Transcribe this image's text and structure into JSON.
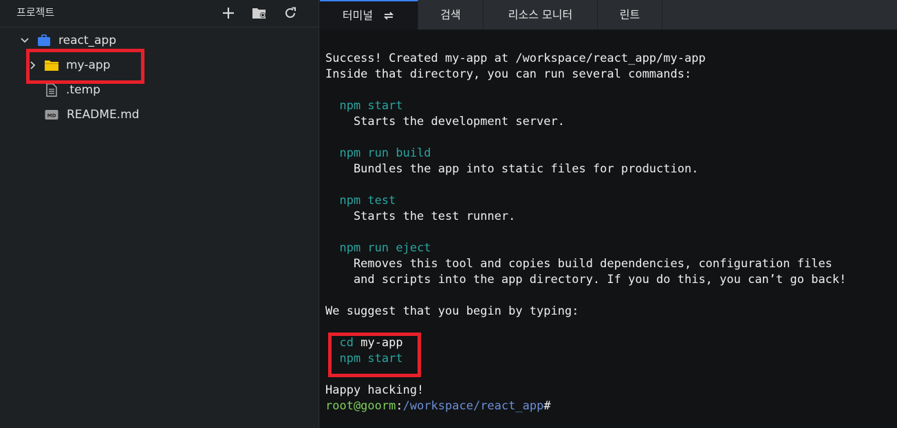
{
  "sidebar": {
    "title": "프로젝트",
    "icons": {
      "add": "plus-icon",
      "new_folder": "folder-settings-icon",
      "refresh": "refresh-icon"
    },
    "tree": [
      {
        "label": "react_app",
        "icon": "project-icon",
        "expanded": true
      },
      {
        "label": "my-app",
        "icon": "folder-icon",
        "expanded": false
      },
      {
        "label": ".temp",
        "icon": "file-icon"
      },
      {
        "label": "README.md",
        "icon": "markdown-file-icon",
        "badge": "MD"
      }
    ]
  },
  "tabs": [
    {
      "label": "터미널",
      "active": true
    },
    {
      "label": "검색"
    },
    {
      "label": "리소스 모니터"
    },
    {
      "label": "린트"
    }
  ],
  "terminal": {
    "lines": [
      {
        "text": "Success! Created my-app at /workspace/react_app/my-app"
      },
      {
        "text": "Inside that directory, you can run several commands:"
      },
      {
        "text": ""
      },
      {
        "cmd": "npm start",
        "indent": "  "
      },
      {
        "text": "    Starts the development server."
      },
      {
        "text": ""
      },
      {
        "cmd": "npm run build",
        "indent": "  "
      },
      {
        "text": "    Bundles the app into static files for production."
      },
      {
        "text": ""
      },
      {
        "cmd": "npm test",
        "indent": "  "
      },
      {
        "text": "    Starts the test runner."
      },
      {
        "text": ""
      },
      {
        "cmd": "npm run eject",
        "indent": "  "
      },
      {
        "text": "    Removes this tool and copies build dependencies, configuration files"
      },
      {
        "text": "    and scripts into the app directory. If you do this, you can’t go back!"
      },
      {
        "text": ""
      },
      {
        "text": "We suggest that you begin by typing:"
      },
      {
        "text": ""
      },
      {
        "cmd": "cd",
        "arg": "my-app",
        "indent": "  "
      },
      {
        "cmd": "npm start",
        "indent": "  "
      },
      {
        "text": ""
      },
      {
        "text": "Happy hacking!"
      }
    ],
    "prompt": {
      "user": "root@goorm",
      "sep": ":",
      "path": "/workspace/react_app",
      "suffix": "#"
    }
  },
  "colors": {
    "accent": "#3b82f6",
    "highlight": "#e8202a",
    "command": "#2aa5a0",
    "prompt_user": "#7fd15a",
    "prompt_path": "#6d8fd8"
  }
}
